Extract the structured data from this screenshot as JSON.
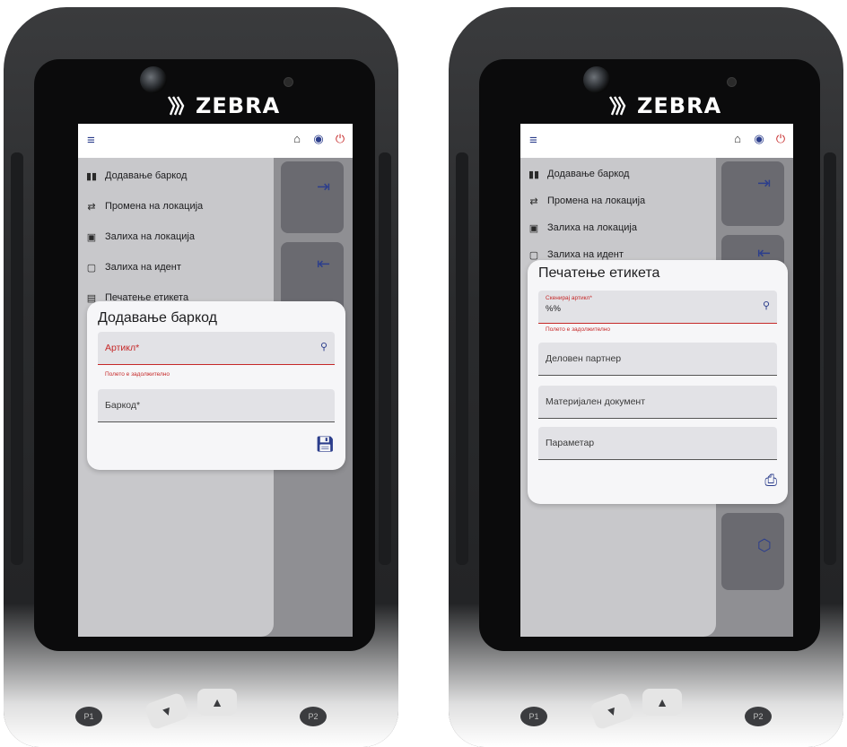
{
  "brand": "ZEBRA",
  "colors": {
    "accent": "#2c3e8c",
    "error": "#c62828",
    "power": "#c62828"
  },
  "topbar_icons": [
    "menu-icon",
    "home-icon",
    "account-icon",
    "power-icon"
  ],
  "drawer": {
    "items": [
      {
        "label": "Додавање баркод",
        "icon": "barcode-icon"
      },
      {
        "label": "Промена на локација",
        "icon": "transfer-icon"
      },
      {
        "label": "Залиха на локација",
        "icon": "warehouse-icon"
      },
      {
        "label": "Залиха на идент",
        "icon": "clipboard-icon"
      },
      {
        "label": "Печатење етикета",
        "icon": "label-print-icon"
      }
    ]
  },
  "left": {
    "dialog": {
      "title": "Додавање баркод",
      "article_label": "Артикл*",
      "article_error": "Полето е задолжително",
      "barcode_label": "Баркод*",
      "action_icon": "save-icon"
    }
  },
  "right": {
    "drawer_items": [
      "Додавање баркод",
      "Промена на локација",
      "Залиха на локација",
      "Залиха на идент"
    ],
    "dialog": {
      "title": "Печатење етикета",
      "scan_label": "Скенирај артикл*",
      "scan_value": "%%",
      "scan_error": "Полето е задолжително",
      "partner_label": "Деловен партнер",
      "document_label": "Материјален документ",
      "parameter_label": "Параметар",
      "action_icon": "print-icon"
    }
  },
  "keypad": {
    "p1": "P1",
    "p2": "P2"
  }
}
